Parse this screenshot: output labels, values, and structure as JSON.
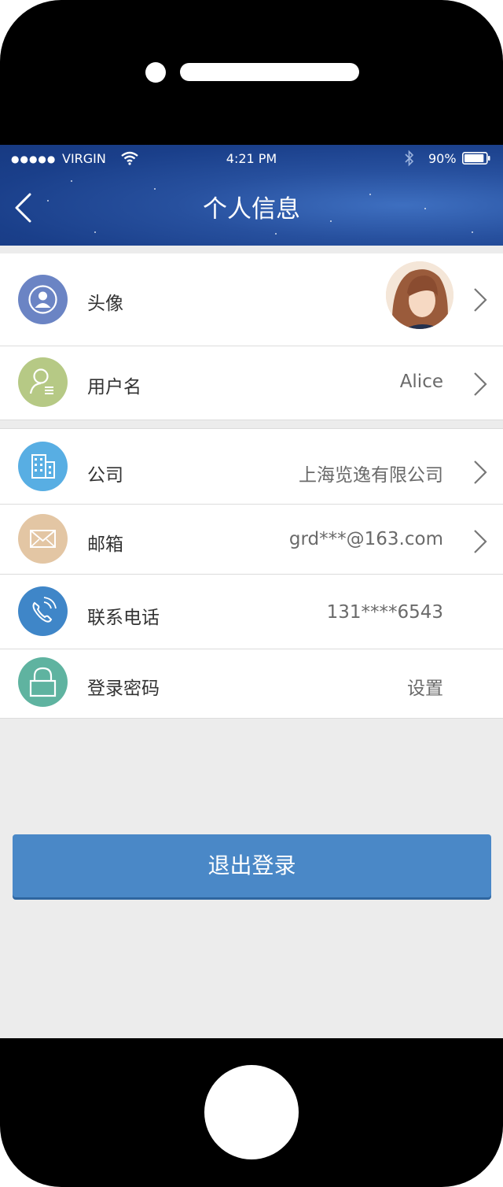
{
  "status_bar": {
    "signal": "●●●●●",
    "carrier": "VIRGIN",
    "time": "4:21 PM",
    "battery_percent": "90%",
    "battery_level": 0.9
  },
  "nav": {
    "back_icon": "chevron-left-icon",
    "title": "个人信息"
  },
  "rows": {
    "avatar": {
      "label": "头像",
      "icon": "user-circle-icon"
    },
    "username": {
      "label": "用户名",
      "value": "Alice",
      "icon": "user-list-icon"
    },
    "company": {
      "label": "公司",
      "value": "上海览逸有限公司",
      "icon": "building-icon"
    },
    "email": {
      "label": "邮箱",
      "value": "grd***@163.com",
      "icon": "envelope-icon"
    },
    "phone": {
      "label": "联系电话",
      "value": "131****6543",
      "icon": "phone-icon"
    },
    "password": {
      "label": "登录密码",
      "value": "设置",
      "icon": "lock-icon"
    }
  },
  "logout_label": "退出登录",
  "colors": {
    "header": "#1f4a97",
    "avatar_icon_bg": "#6b84c4",
    "username_icon_bg": "#b6c985",
    "company_icon_bg": "#58aee3",
    "email_icon_bg": "#e3c6a4",
    "phone_icon_bg": "#3f86c8",
    "password_icon_bg": "#5fb3a0",
    "logout_button": "#4a88c7"
  }
}
